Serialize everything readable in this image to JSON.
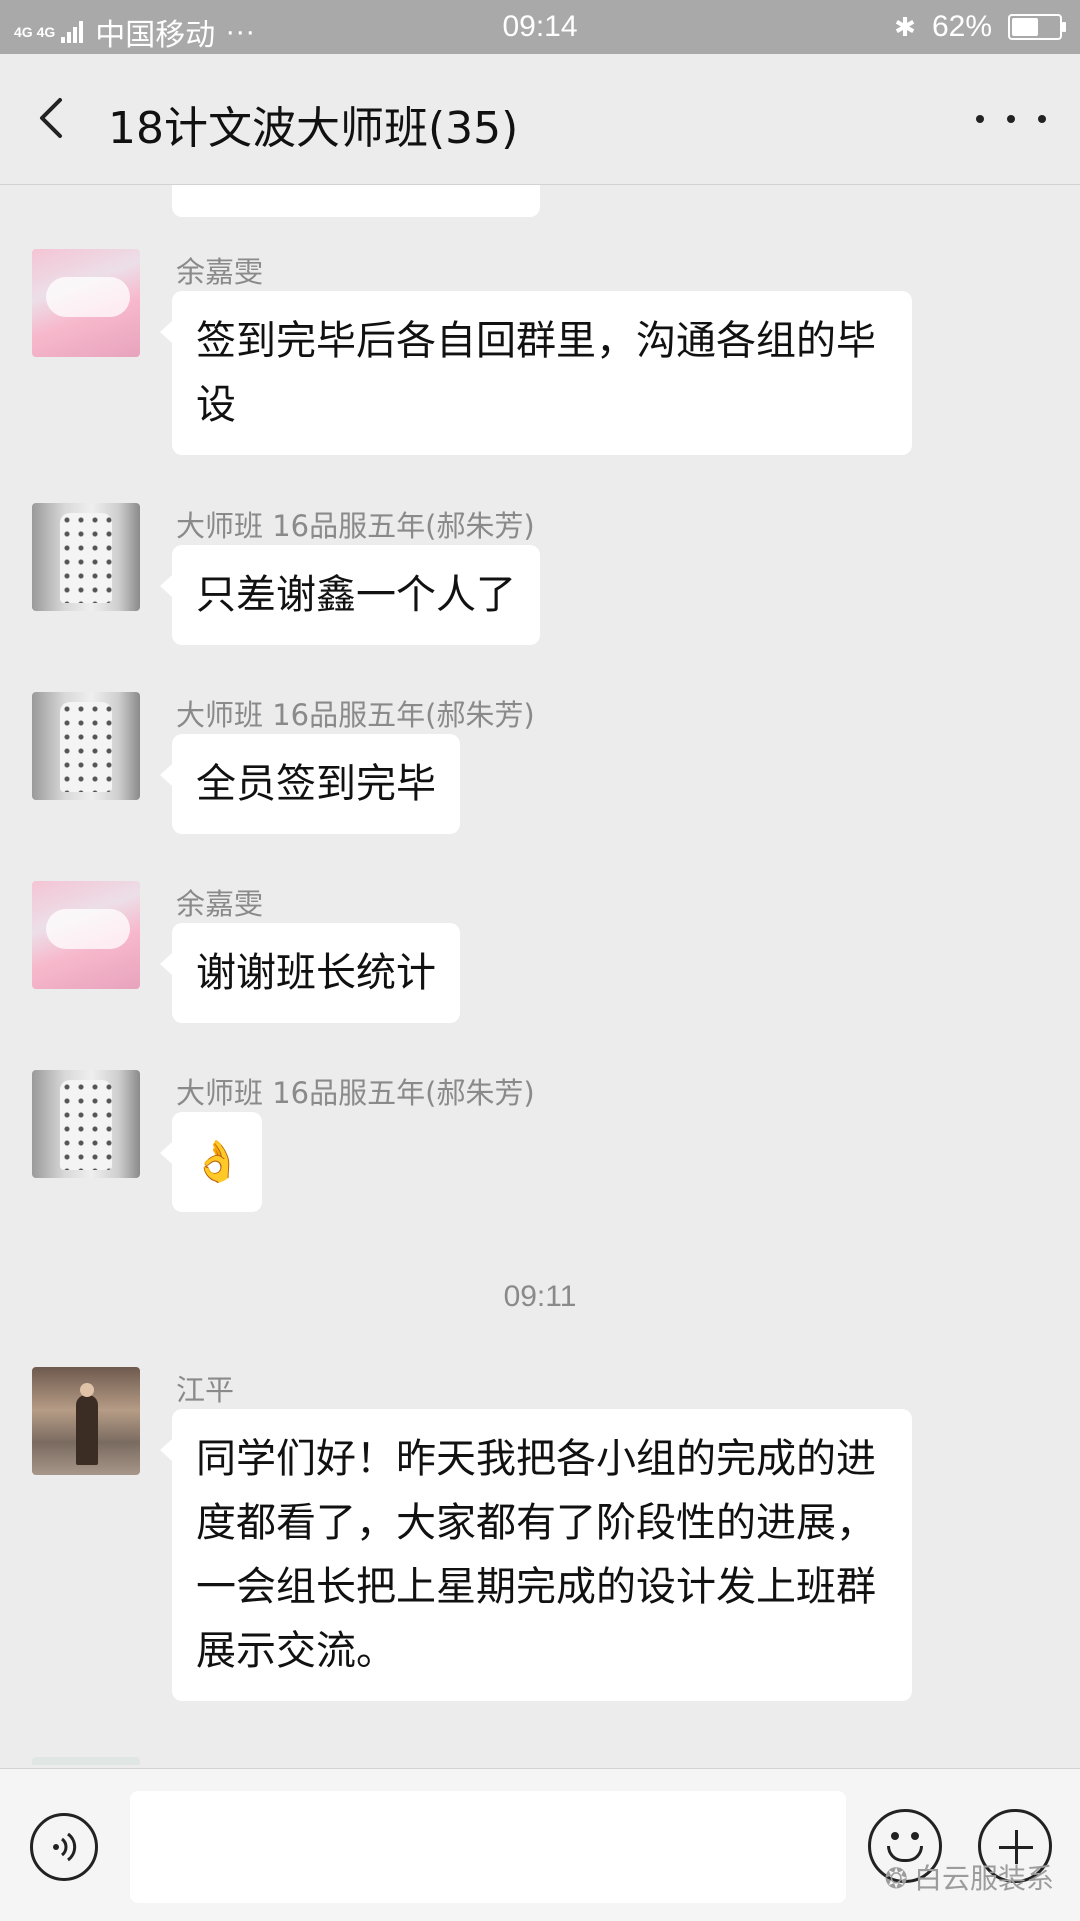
{
  "status_bar": {
    "network": "4G 4G",
    "carrier": "中国移动",
    "more": "···",
    "time": "09:14",
    "battery": "62%",
    "battery_level": 0.62
  },
  "header": {
    "title": "18计文波大师班(35)"
  },
  "messages": [
    {
      "sender": "余嘉雯",
      "text": "签到完毕后各自回群里，沟通各组的毕设"
    },
    {
      "sender": "大师班 16品服五年(郝朱芳)",
      "text": "只差谢鑫一个人了"
    },
    {
      "sender": "大师班 16品服五年(郝朱芳)",
      "text": "全员签到完毕"
    },
    {
      "sender": "余嘉雯",
      "text": "谢谢班长统计"
    },
    {
      "sender": "大师班 16品服五年(郝朱芳)",
      "text": "👌"
    },
    {
      "sender": "江平",
      "text": "同学们好！昨天我把各小组的完成的进度都看了，大家都有了阶段性的进展，一会组长把上星期完成的设计发上班群展示交流。"
    }
  ],
  "timestamp": "09:11",
  "watermark": "白云服装系",
  "icons": {
    "back": "chevron-left-icon",
    "more": "more-dots-icon",
    "voice": "voice-icon",
    "emoji": "emoji-icon",
    "plus": "plus-icon"
  }
}
